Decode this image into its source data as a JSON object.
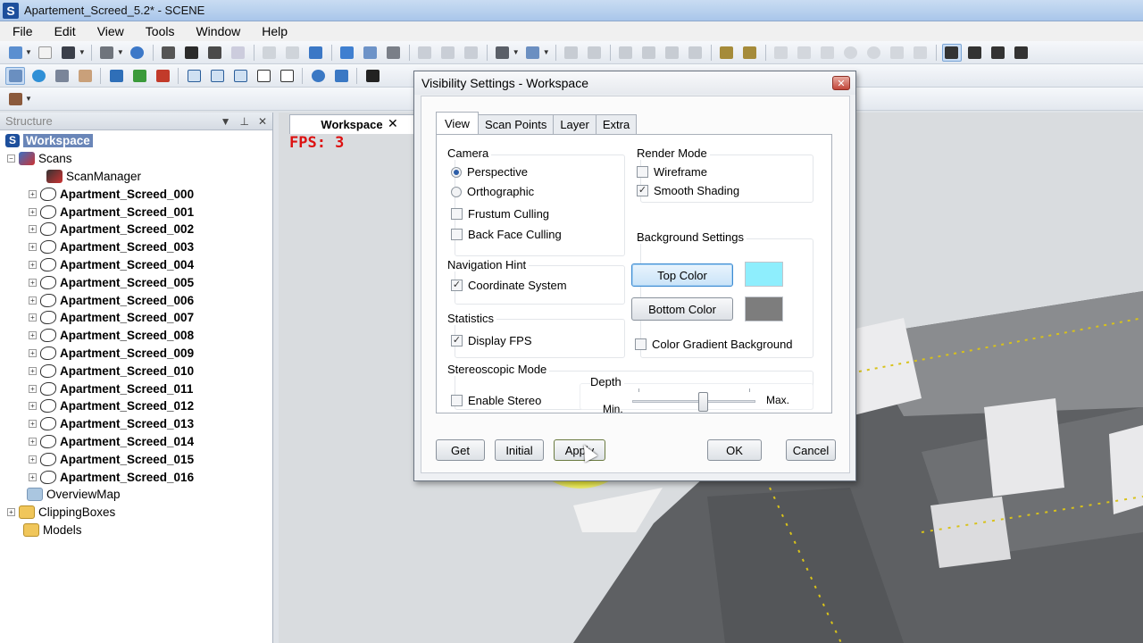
{
  "window": {
    "title": "Apartement_Screed_5.2* - SCENE",
    "app_icon": "S"
  },
  "menu": [
    "File",
    "Edit",
    "View",
    "Tools",
    "Window",
    "Help"
  ],
  "structure_panel": {
    "title": "Structure",
    "root": "Workspace",
    "scans_label": "Scans",
    "scan_manager": "ScanManager",
    "scans": [
      "Apartment_Screed_000",
      "Apartment_Screed_001",
      "Apartment_Screed_002",
      "Apartment_Screed_003",
      "Apartment_Screed_004",
      "Apartment_Screed_005",
      "Apartment_Screed_006",
      "Apartment_Screed_007",
      "Apartment_Screed_008",
      "Apartment_Screed_009",
      "Apartment_Screed_010",
      "Apartment_Screed_011",
      "Apartment_Screed_012",
      "Apartment_Screed_013",
      "Apartment_Screed_014",
      "Apartment_Screed_015",
      "Apartment_Screed_016"
    ],
    "overview_map": "OverviewMap",
    "clipping_boxes": "ClippingBoxes",
    "models": "Models"
  },
  "viewport": {
    "tab_label": "Workspace",
    "fps_text": "FPS: 3"
  },
  "dialog": {
    "title": "Visibility Settings - Workspace",
    "tabs": [
      "View",
      "Scan Points",
      "Layer",
      "Extra"
    ],
    "active_tab": "View",
    "camera": {
      "title": "Camera",
      "perspective": "Perspective",
      "orthographic": "Orthographic",
      "frustum_culling": "Frustum Culling",
      "back_face_culling": "Back Face Culling",
      "selected": "Perspective"
    },
    "navigation_hint": {
      "title": "Navigation Hint",
      "coordinate_system": "Coordinate System",
      "checked": true
    },
    "statistics": {
      "title": "Statistics",
      "display_fps": "Display FPS",
      "checked": true
    },
    "render_mode": {
      "title": "Render Mode",
      "wireframe": "Wireframe",
      "smooth_shading": "Smooth Shading",
      "wireframe_checked": false,
      "smooth_checked": true
    },
    "background": {
      "title": "Background Settings",
      "top_color_label": "Top Color",
      "bottom_color_label": "Bottom Color",
      "top_color": "#8eeefd",
      "bottom_color": "#7d7d7d",
      "gradient_label": "Color Gradient Background",
      "gradient_checked": false
    },
    "stereo": {
      "title": "Stereoscopic Mode",
      "enable_label": "Enable Stereo",
      "enabled": false,
      "depth_label": "Depth",
      "min_label": "Min.",
      "max_label": "Max.",
      "depth_value": 0.57
    },
    "buttons": {
      "get": "Get",
      "initial": "Initial",
      "apply": "Apply",
      "ok": "OK",
      "cancel": "Cancel"
    }
  },
  "icons": [
    "new-icon",
    "open-icon",
    "save-icon",
    "print-icon",
    "help-icon",
    "3d-icon",
    "home-icon",
    "navigate-icon",
    "zoom-icon"
  ]
}
